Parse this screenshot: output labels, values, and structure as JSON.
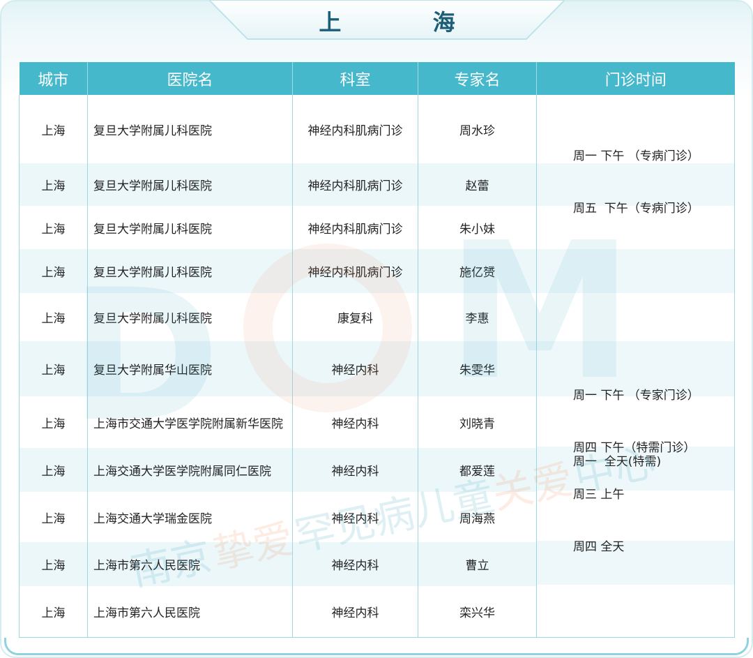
{
  "title": "上 海",
  "headers": {
    "city": "城市",
    "hospital": "医院名",
    "department": "科室",
    "expert": "专家名",
    "clinic_time": "门诊时间"
  },
  "rows": [
    {
      "city": "上海",
      "hospital": "复旦大学附属儿科医院",
      "department": "神经内科肌病门诊",
      "expert": "周水珍"
    },
    {
      "city": "上海",
      "hospital": "复旦大学附属儿科医院",
      "department": "神经内科肌病门诊",
      "expert": "赵蕾"
    },
    {
      "city": "上海",
      "hospital": "复旦大学附属儿科医院",
      "department": "神经内科肌病门诊",
      "expert": "朱小妹"
    },
    {
      "city": "上海",
      "hospital": "复旦大学附属儿科医院",
      "department": "神经内科肌病门诊",
      "expert": "施亿赟"
    },
    {
      "city": "上海",
      "hospital": "复旦大学附属儿科医院",
      "department": "康复科",
      "expert": "李惠"
    },
    {
      "city": "上海",
      "hospital": "复旦大学附属华山医院",
      "department": "神经内科",
      "expert": "朱雯华"
    },
    {
      "city": "上海",
      "hospital": "上海市交通大学医学院附属新华医院",
      "department": "神经内科",
      "expert": "刘晓青"
    },
    {
      "city": "上海",
      "hospital": "上海交通大学医学院附属同仁医院",
      "department": "神经内科",
      "expert": "都爱莲"
    },
    {
      "city": "上海",
      "hospital": "上海交通大学瑞金医院",
      "department": "神经内科",
      "expert": "周海燕"
    },
    {
      "city": "上海",
      "hospital": "上海市第六人民医院",
      "department": "神经内科",
      "expert": "曹立"
    },
    {
      "city": "上海",
      "hospital": "上海市第六人民医院",
      "department": "神经内科",
      "expert": "栾兴华"
    }
  ],
  "clinic_times": [
    {
      "line1": "周一 下午 （专病门诊）",
      "line2": "周五  下午（专病门诊）"
    },
    {
      "line1": "周一 下午 （专家门诊）",
      "line2": "周四 下午（特需门诊）"
    },
    {
      "line1": "周一  全天(特需)"
    },
    {
      "line1": "周三 上午",
      "line2": "周四 全天"
    }
  ],
  "watermark": {
    "logo_text": "DCM",
    "org_text": "南京挚爱罕见病儿童关爱中心"
  },
  "colors": {
    "header_bg": "#45b8cc",
    "title_text": "#1c5e78",
    "grid_line": "#9fd7e1"
  }
}
